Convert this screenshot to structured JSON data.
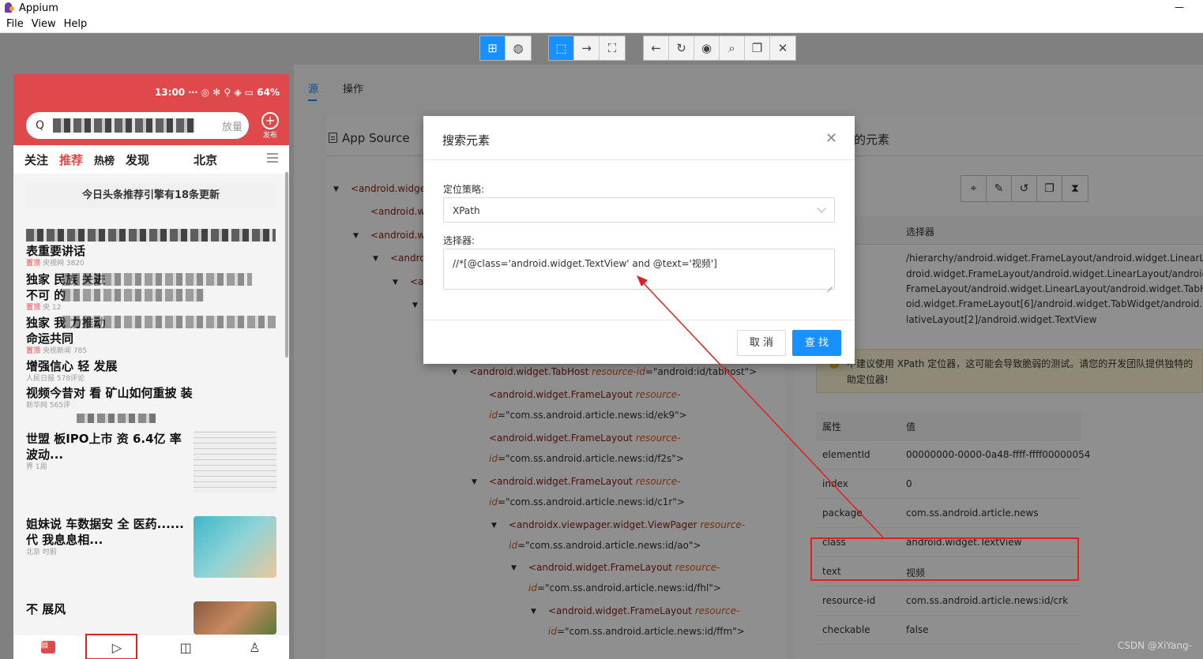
{
  "window": {
    "title": "Appium",
    "minimize_glyph": "—"
  },
  "menu": [
    "File",
    "View",
    "Help"
  ],
  "toolbar": {
    "group1": [
      {
        "icon": "grid-icon",
        "glyph": "⊞",
        "active": true
      },
      {
        "icon": "globe-icon",
        "glyph": "◍",
        "active": false
      }
    ],
    "group2": [
      {
        "icon": "select-cursor-icon",
        "glyph": "⬚",
        "active": true
      },
      {
        "icon": "swipe-arrow-icon",
        "glyph": "→",
        "active": false
      },
      {
        "icon": "tap-by-coordinates-icon",
        "glyph": "⛶",
        "active": false
      }
    ],
    "group3": [
      {
        "icon": "back-icon",
        "glyph": "←"
      },
      {
        "icon": "refresh-icon",
        "glyph": "↻"
      },
      {
        "icon": "eye-icon",
        "glyph": "◉"
      },
      {
        "icon": "search-icon",
        "glyph": "⌕"
      },
      {
        "icon": "copy-icon",
        "glyph": "❐"
      },
      {
        "icon": "close-icon",
        "glyph": "✕"
      }
    ]
  },
  "phone": {
    "status": "13:00 ⋯ ◎ ✻ ⚲ ◈ ▭ 64%",
    "search_placeholder": "",
    "search_hot": "放量",
    "publish_label": "发布",
    "tabs": [
      "关注",
      "推荐",
      "热榜",
      "发现",
      "北京"
    ],
    "update_notice": "今日头条推荐引擎有18条更新",
    "news": [
      {
        "title": "表重要讲话",
        "tag": "置顶",
        "meta": "央视网 3820"
      },
      {
        "title": "独家  民族  关进",
        "tag": "",
        "meta": ""
      },
      {
        "title": "不可  的",
        "tag": "置顶",
        "meta": "央  12"
      },
      {
        "title": "独家    我   力推动",
        "tag": "",
        "meta": ""
      },
      {
        "title": "命运共同",
        "tag": "置顶",
        "meta": "央视新闻 785"
      },
      {
        "title": "增强信心 轻    发展",
        "tag": "",
        "meta": "人民日报 578评论"
      },
      {
        "title": "视频今昔对   看   矿山如何重披   装",
        "tag": "",
        "meta": "新华网 565评"
      },
      {
        "title": "世盟   板IPO上市    资 6.4亿     率波动...",
        "tag": "",
        "meta": "界   1周"
      },
      {
        "title": "姐妹说    车数据安 全    医药......代       我息息相...",
        "tag": "",
        "meta": "北京    时前"
      },
      {
        "title": "不    展风",
        "tag": "",
        "meta": ""
      }
    ],
    "nav": [
      {
        "icon": "home-icon",
        "glyph": "▤"
      },
      {
        "icon": "video-play-icon",
        "glyph": "▷"
      },
      {
        "icon": "task-icon",
        "glyph": "◫"
      },
      {
        "icon": "profile-icon",
        "glyph": "♙"
      }
    ]
  },
  "panel_tabs": [
    "源",
    "操作"
  ],
  "source": {
    "header": "App Source",
    "tree": [
      {
        "indent": 0,
        "caret": "▼",
        "tag": "<android.widget"
      },
      {
        "indent": 1,
        "caret": "",
        "tag": "<android.wi"
      },
      {
        "indent": 1,
        "caret": "▼",
        "tag": "<android.wi"
      },
      {
        "indent": 2,
        "caret": "▼",
        "tag": "<andro"
      },
      {
        "indent": 3,
        "caret": "▼",
        "tag": "<a"
      },
      {
        "indent": 4,
        "caret": "▼",
        "tag": ""
      },
      {
        "indent": 6,
        "caret": "▼",
        "tag": "<android.widget.TabHost ",
        "attr": "resource-id",
        "val": "=\"android:id/tabhost\">"
      },
      {
        "indent": 7,
        "caret": "",
        "tag": "<android.widget.FrameLayout ",
        "attr": "resource-",
        "val": ""
      },
      {
        "indent": 7,
        "caret": "",
        "tag": "",
        "attr": "id",
        "val": "=\"com.ss.android.article.news:id/ek9\">"
      },
      {
        "indent": 7,
        "caret": "",
        "tag": "<android.widget.FrameLayout ",
        "attr": "resource-",
        "val": ""
      },
      {
        "indent": 7,
        "caret": "",
        "tag": "",
        "attr": "id",
        "val": "=\"com.ss.android.article.news:id/f2s\">"
      },
      {
        "indent": 7,
        "caret": "▼",
        "tag": "<android.widget.FrameLayout ",
        "attr": "resource-",
        "val": ""
      },
      {
        "indent": 7,
        "caret": "",
        "tag": "",
        "attr": "id",
        "val": "=\"com.ss.android.article.news:id/c1r\">"
      },
      {
        "indent": 8,
        "caret": "▼",
        "tag": "<androidx.viewpager.widget.ViewPager ",
        "attr": "resource-",
        "val": ""
      },
      {
        "indent": 8,
        "caret": "",
        "tag": "",
        "attr": "id",
        "val": "=\"com.ss.android.article.news:id/ao\">"
      },
      {
        "indent": 9,
        "caret": "▼",
        "tag": "<android.widget.FrameLayout ",
        "attr": "resource-",
        "val": ""
      },
      {
        "indent": 9,
        "caret": "",
        "tag": "",
        "attr": "id",
        "val": "=\"com.ss.android.article.news:id/fhl\">"
      },
      {
        "indent": 10,
        "caret": "▼",
        "tag": "<android.widget.FrameLayout ",
        "attr": "resource-",
        "val": ""
      },
      {
        "indent": 10,
        "caret": "",
        "tag": "",
        "attr": "id",
        "val": "=\"com.ss.android.article.news:id/ffm\">"
      }
    ]
  },
  "selected": {
    "header": "的元素",
    "actions": [
      {
        "icon": "tap-icon",
        "glyph": "⌖"
      },
      {
        "icon": "send-keys-icon",
        "glyph": "✎"
      },
      {
        "icon": "clear-icon",
        "glyph": "↺"
      },
      {
        "icon": "copy-attributes-icon",
        "glyph": "❐"
      },
      {
        "icon": "timing-icon",
        "glyph": "⧗"
      }
    ],
    "selector_header": "选择器",
    "selector_lines": [
      "/hierarchy/android.widget.FrameLayout/android.widget.LinearLayou",
      "droid.widget.FrameLayout/android.widget.LinearLayout/android.wid",
      "FrameLayout/android.widget.LinearLayout/android.widget.TabHost/",
      "oid.widget.FrameLayout[6]/android.widget.TabWidget/android.widg",
      "lativeLayout[2]/android.widget.TextView"
    ],
    "warning": "不建议使用 XPath 定位器，这可能会导致脆弱的测试。请您的开发团队提供独特的助定位器!",
    "attr_header": {
      "key": "属性",
      "value": "值"
    },
    "attributes": [
      {
        "key": "elementId",
        "value": "00000000-0000-0a48-ffff-ffff00000054"
      },
      {
        "key": "index",
        "value": "0"
      },
      {
        "key": "package",
        "value": "com.ss.android.article.news"
      },
      {
        "key": "class",
        "value": "android.widget.TextView"
      },
      {
        "key": "text",
        "value": "视频"
      },
      {
        "key": "resource-id",
        "value": "com.ss.android.article.news:id/crk"
      },
      {
        "key": "checkable",
        "value": "false"
      }
    ]
  },
  "modal": {
    "title": "搜索元素",
    "close_glyph": "✕",
    "strategy_label": "定位策略:",
    "strategy_value": "XPath",
    "selector_label": "选择器:",
    "selector_value": "//*[@class='android.widget.TextView' and @text='视频']",
    "cancel_label": "取 消",
    "find_label": "查 找"
  },
  "watermark": "CSDN @XiYang-",
  "colors": {
    "accent": "#1890ff",
    "annotation": "#e02020",
    "phone_brand": "#e0494b"
  }
}
